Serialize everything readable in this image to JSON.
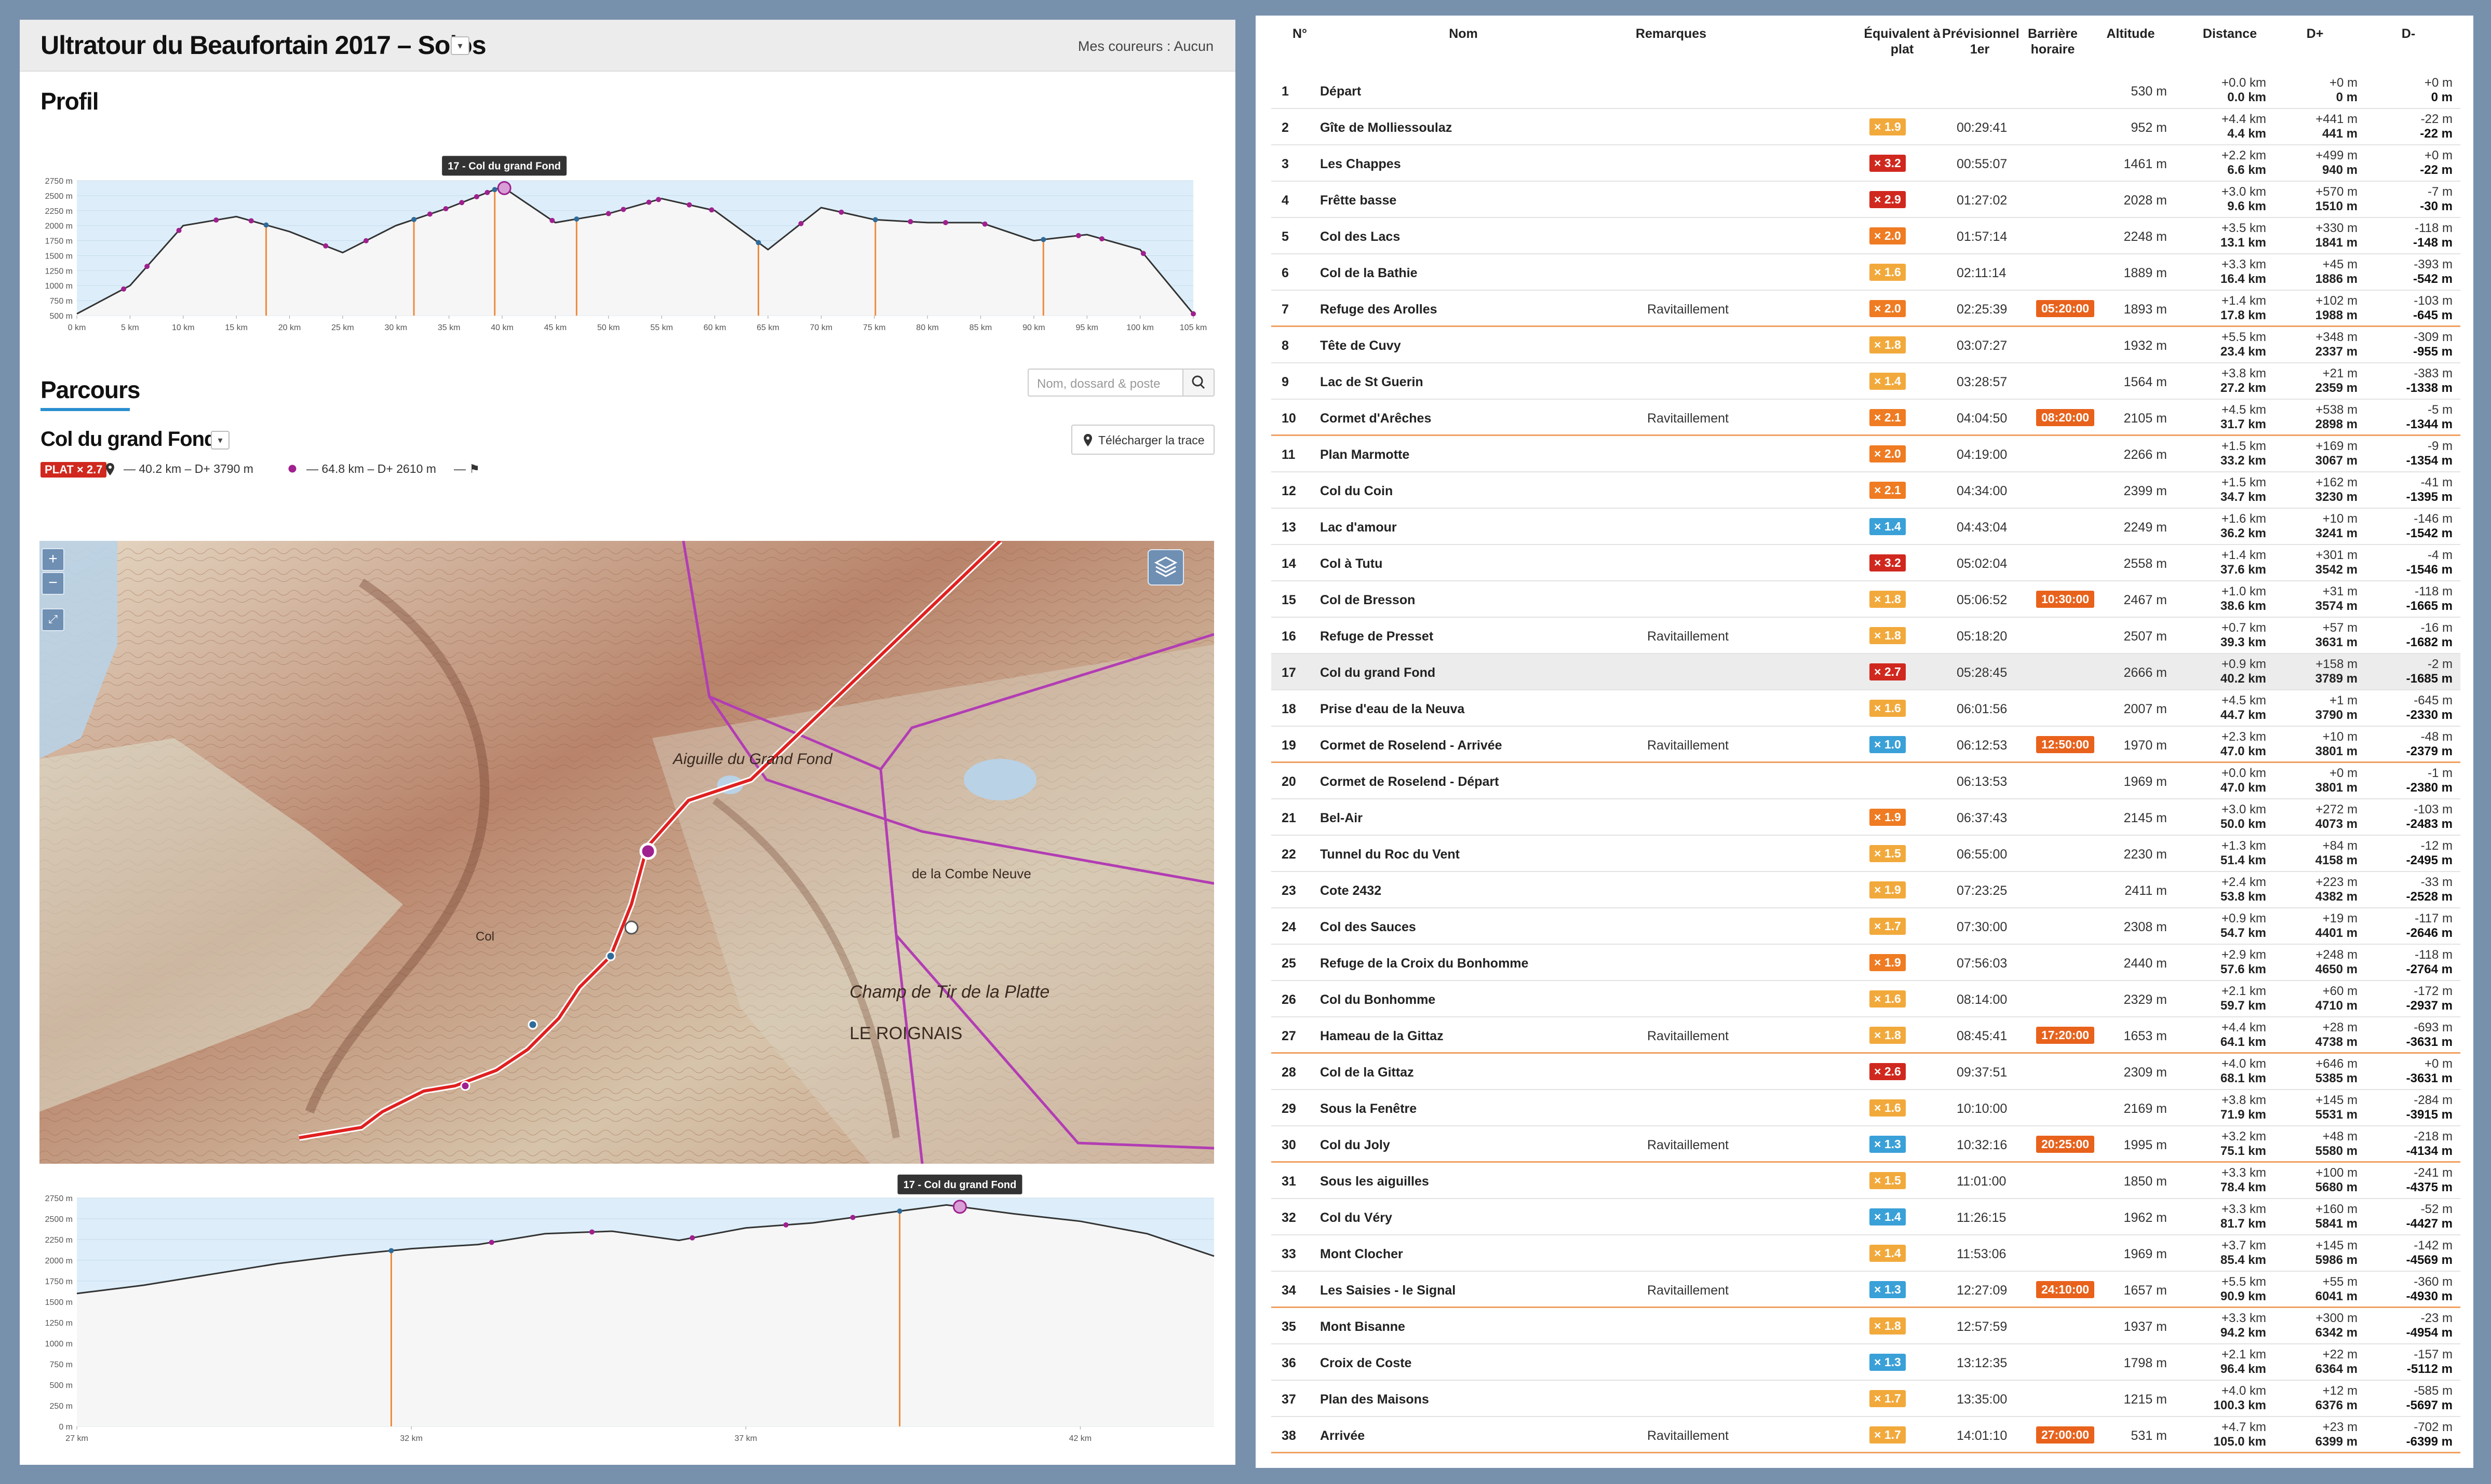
{
  "header": {
    "title": "Ultratour du Beaufortain 2017 – Solos",
    "mes_coureurs": "Mes coureurs : Aucun"
  },
  "profil": {
    "heading": "Profil",
    "tooltip": "17 - Col du grand Fond"
  },
  "parcours": {
    "heading": "Parcours",
    "search_placeholder": "Nom, dossard & poste",
    "section": "Col du grand Fond",
    "download": "Télécharger la trace",
    "plat_badge": "PLAT × 2.7",
    "from_stat": "40.2 km – D+ 3790 m",
    "to_stat": "64.8 km – D+ 2610 m"
  },
  "colors": {
    "accent": "#2a8fd0",
    "route": "#e02020",
    "checkpoint": "#a0208f",
    "barrier": "#e8621c",
    "eq_red": "#d0281e",
    "eq_orange": "#ef7b22",
    "eq_yellow": "#f2a93b",
    "eq_blue": "#3aa0d8"
  },
  "table": {
    "headers": {
      "n": "N°",
      "nom": "Nom",
      "rem": "Remarques",
      "eq": "Équivalent à plat",
      "prev": "Prévisionnel 1er",
      "bar": "Barrière horaire",
      "alt": "Altitude",
      "dist": "Distance",
      "dp": "D+",
      "dm": "D-"
    },
    "rows": [
      {
        "n": "1",
        "name": "Départ",
        "rem": "",
        "eq": "",
        "eqc": "",
        "prev": "",
        "bar": "",
        "alt": "530 m",
        "d1": "+0.0 km",
        "d2": "0.0 km",
        "p1": "+0 m",
        "p2": "0 m",
        "m1": "+0 m",
        "m2": "0 m"
      },
      {
        "n": "2",
        "name": "Gîte de Molliessoulaz",
        "rem": "",
        "eq": "× 1.9",
        "eqc": "y",
        "prev": "00:29:41",
        "bar": "",
        "alt": "952 m",
        "d1": "+4.4 km",
        "d2": "4.4 km",
        "p1": "+441 m",
        "p2": "441 m",
        "m1": "-22 m",
        "m2": "-22 m"
      },
      {
        "n": "3",
        "name": "Les Chappes",
        "rem": "",
        "eq": "× 3.2",
        "eqc": "r",
        "prev": "00:55:07",
        "bar": "",
        "alt": "1461 m",
        "d1": "+2.2 km",
        "d2": "6.6 km",
        "p1": "+499 m",
        "p2": "940 m",
        "m1": "+0 m",
        "m2": "-22 m"
      },
      {
        "n": "4",
        "name": "Frêtte basse",
        "rem": "",
        "eq": "× 2.9",
        "eqc": "r",
        "prev": "01:27:02",
        "bar": "",
        "alt": "2028 m",
        "d1": "+3.0 km",
        "d2": "9.6 km",
        "p1": "+570 m",
        "p2": "1510 m",
        "m1": "-7 m",
        "m2": "-30 m"
      },
      {
        "n": "5",
        "name": "Col des Lacs",
        "rem": "",
        "eq": "× 2.0",
        "eqc": "o",
        "prev": "01:57:14",
        "bar": "",
        "alt": "2248 m",
        "d1": "+3.5 km",
        "d2": "13.1 km",
        "p1": "+330 m",
        "p2": "1841 m",
        "m1": "-118 m",
        "m2": "-148 m"
      },
      {
        "n": "6",
        "name": "Col de la Bathie",
        "rem": "",
        "eq": "× 1.6",
        "eqc": "y",
        "prev": "02:11:14",
        "bar": "",
        "alt": "1889 m",
        "d1": "+3.3 km",
        "d2": "16.4 km",
        "p1": "+45 m",
        "p2": "1886 m",
        "m1": "-393 m",
        "m2": "-542 m"
      },
      {
        "n": "7",
        "name": "Refuge des Arolles",
        "rem": "Ravitaillement",
        "eq": "× 2.0",
        "eqc": "o",
        "prev": "02:25:39",
        "bar": "05:20:00",
        "alt": "1893 m",
        "d1": "+1.4 km",
        "d2": "17.8 km",
        "p1": "+102 m",
        "p2": "1988 m",
        "m1": "-103 m",
        "m2": "-645 m"
      },
      {
        "n": "8",
        "name": "Tête de Cuvy",
        "rem": "",
        "eq": "× 1.8",
        "eqc": "y",
        "prev": "03:07:27",
        "bar": "",
        "alt": "1932 m",
        "d1": "+5.5 km",
        "d2": "23.4 km",
        "p1": "+348 m",
        "p2": "2337 m",
        "m1": "-309 m",
        "m2": "-955 m"
      },
      {
        "n": "9",
        "name": "Lac de St Guerin",
        "rem": "",
        "eq": "× 1.4",
        "eqc": "y",
        "prev": "03:28:57",
        "bar": "",
        "alt": "1564 m",
        "d1": "+3.8 km",
        "d2": "27.2 km",
        "p1": "+21 m",
        "p2": "2359 m",
        "m1": "-383 m",
        "m2": "-1338 m"
      },
      {
        "n": "10",
        "name": "Cormet d'Arêches",
        "rem": "Ravitaillement",
        "eq": "× 2.1",
        "eqc": "o",
        "prev": "04:04:50",
        "bar": "08:20:00",
        "alt": "2105 m",
        "d1": "+4.5 km",
        "d2": "31.7 km",
        "p1": "+538 m",
        "p2": "2898 m",
        "m1": "-5 m",
        "m2": "-1344 m"
      },
      {
        "n": "11",
        "name": "Plan Marmotte",
        "rem": "",
        "eq": "× 2.0",
        "eqc": "o",
        "prev": "04:19:00",
        "bar": "",
        "alt": "2266 m",
        "d1": "+1.5 km",
        "d2": "33.2 km",
        "p1": "+169 m",
        "p2": "3067 m",
        "m1": "-9 m",
        "m2": "-1354 m"
      },
      {
        "n": "12",
        "name": "Col du Coin",
        "rem": "",
        "eq": "× 2.1",
        "eqc": "o",
        "prev": "04:34:00",
        "bar": "",
        "alt": "2399 m",
        "d1": "+1.5 km",
        "d2": "34.7 km",
        "p1": "+162 m",
        "p2": "3230 m",
        "m1": "-41 m",
        "m2": "-1395 m"
      },
      {
        "n": "13",
        "name": "Lac d'amour",
        "rem": "",
        "eq": "× 1.4",
        "eqc": "b",
        "prev": "04:43:04",
        "bar": "",
        "alt": "2249 m",
        "d1": "+1.6 km",
        "d2": "36.2 km",
        "p1": "+10 m",
        "p2": "3241 m",
        "m1": "-146 m",
        "m2": "-1542 m"
      },
      {
        "n": "14",
        "name": "Col à Tutu",
        "rem": "",
        "eq": "× 3.2",
        "eqc": "r",
        "prev": "05:02:04",
        "bar": "",
        "alt": "2558 m",
        "d1": "+1.4 km",
        "d2": "37.6 km",
        "p1": "+301 m",
        "p2": "3542 m",
        "m1": "-4 m",
        "m2": "-1546 m"
      },
      {
        "n": "15",
        "name": "Col de Bresson",
        "rem": "",
        "eq": "× 1.8",
        "eqc": "y",
        "prev": "05:06:52",
        "bar": "10:30:00",
        "alt": "2467 m",
        "d1": "+1.0 km",
        "d2": "38.6 km",
        "p1": "+31 m",
        "p2": "3574 m",
        "m1": "-118 m",
        "m2": "-1665 m"
      },
      {
        "n": "16",
        "name": "Refuge de Presset",
        "rem": "Ravitaillement",
        "eq": "× 1.8",
        "eqc": "y",
        "prev": "05:18:20",
        "bar": "",
        "alt": "2507 m",
        "d1": "+0.7 km",
        "d2": "39.3 km",
        "p1": "+57 m",
        "p2": "3631 m",
        "m1": "-16 m",
        "m2": "-1682 m"
      },
      {
        "n": "17",
        "name": "Col du grand Fond",
        "rem": "",
        "eq": "× 2.7",
        "eqc": "r",
        "prev": "05:28:45",
        "bar": "",
        "alt": "2666 m",
        "d1": "+0.9 km",
        "d2": "40.2 km",
        "p1": "+158 m",
        "p2": "3789 m",
        "m1": "-2 m",
        "m2": "-1685 m"
      },
      {
        "n": "18",
        "name": "Prise d'eau de la Neuva",
        "rem": "",
        "eq": "× 1.6",
        "eqc": "y",
        "prev": "06:01:56",
        "bar": "",
        "alt": "2007 m",
        "d1": "+4.5 km",
        "d2": "44.7 km",
        "p1": "+1 m",
        "p2": "3790 m",
        "m1": "-645 m",
        "m2": "-2330 m"
      },
      {
        "n": "19",
        "name": "Cormet de Roselend - Arrivée",
        "rem": "Ravitaillement",
        "eq": "× 1.0",
        "eqc": "b",
        "prev": "06:12:53",
        "bar": "12:50:00",
        "alt": "1970 m",
        "d1": "+2.3 km",
        "d2": "47.0 km",
        "p1": "+10 m",
        "p2": "3801 m",
        "m1": "-48 m",
        "m2": "-2379 m"
      },
      {
        "n": "20",
        "name": "Cormet de Roselend - Départ",
        "rem": "",
        "eq": "",
        "eqc": "",
        "prev": "06:13:53",
        "bar": "",
        "alt": "1969 m",
        "d1": "+0.0 km",
        "d2": "47.0 km",
        "p1": "+0 m",
        "p2": "3801 m",
        "m1": "-1 m",
        "m2": "-2380 m"
      },
      {
        "n": "21",
        "name": "Bel-Air",
        "rem": "",
        "eq": "× 1.9",
        "eqc": "o",
        "prev": "06:37:43",
        "bar": "",
        "alt": "2145 m",
        "d1": "+3.0 km",
        "d2": "50.0 km",
        "p1": "+272 m",
        "p2": "4073 m",
        "m1": "-103 m",
        "m2": "-2483 m"
      },
      {
        "n": "22",
        "name": "Tunnel du Roc du Vent",
        "rem": "",
        "eq": "× 1.5",
        "eqc": "y",
        "prev": "06:55:00",
        "bar": "",
        "alt": "2230 m",
        "d1": "+1.3 km",
        "d2": "51.4 km",
        "p1": "+84 m",
        "p2": "4158 m",
        "m1": "-12 m",
        "m2": "-2495 m"
      },
      {
        "n": "23",
        "name": "Cote 2432",
        "rem": "",
        "eq": "× 1.9",
        "eqc": "y",
        "prev": "07:23:25",
        "bar": "",
        "alt": "2411 m",
        "d1": "+2.4 km",
        "d2": "53.8 km",
        "p1": "+223 m",
        "p2": "4382 m",
        "m1": "-33 m",
        "m2": "-2528 m"
      },
      {
        "n": "24",
        "name": "Col des Sauces",
        "rem": "",
        "eq": "× 1.7",
        "eqc": "y",
        "prev": "07:30:00",
        "bar": "",
        "alt": "2308 m",
        "d1": "+0.9 km",
        "d2": "54.7 km",
        "p1": "+19 m",
        "p2": "4401 m",
        "m1": "-117 m",
        "m2": "-2646 m"
      },
      {
        "n": "25",
        "name": "Refuge de la Croix du Bonhomme",
        "rem": "",
        "eq": "× 1.9",
        "eqc": "o",
        "prev": "07:56:03",
        "bar": "",
        "alt": "2440 m",
        "d1": "+2.9 km",
        "d2": "57.6 km",
        "p1": "+248 m",
        "p2": "4650 m",
        "m1": "-118 m",
        "m2": "-2764 m"
      },
      {
        "n": "26",
        "name": "Col du Bonhomme",
        "rem": "",
        "eq": "× 1.6",
        "eqc": "y",
        "prev": "08:14:00",
        "bar": "",
        "alt": "2329 m",
        "d1": "+2.1 km",
        "d2": "59.7 km",
        "p1": "+60 m",
        "p2": "4710 m",
        "m1": "-172 m",
        "m2": "-2937 m"
      },
      {
        "n": "27",
        "name": "Hameau de la Gittaz",
        "rem": "Ravitaillement",
        "eq": "× 1.8",
        "eqc": "y",
        "prev": "08:45:41",
        "bar": "17:20:00",
        "alt": "1653 m",
        "d1": "+4.4 km",
        "d2": "64.1 km",
        "p1": "+28 m",
        "p2": "4738 m",
        "m1": "-693 m",
        "m2": "-3631 m"
      },
      {
        "n": "28",
        "name": "Col de la Gittaz",
        "rem": "",
        "eq": "× 2.6",
        "eqc": "r",
        "prev": "09:37:51",
        "bar": "",
        "alt": "2309 m",
        "d1": "+4.0 km",
        "d2": "68.1 km",
        "p1": "+646 m",
        "p2": "5385 m",
        "m1": "+0 m",
        "m2": "-3631 m"
      },
      {
        "n": "29",
        "name": "Sous la Fenêtre",
        "rem": "",
        "eq": "× 1.6",
        "eqc": "y",
        "prev": "10:10:00",
        "bar": "",
        "alt": "2169 m",
        "d1": "+3.8 km",
        "d2": "71.9 km",
        "p1": "+145 m",
        "p2": "5531 m",
        "m1": "-284 m",
        "m2": "-3915 m"
      },
      {
        "n": "30",
        "name": "Col du Joly",
        "rem": "Ravitaillement",
        "eq": "× 1.3",
        "eqc": "b",
        "prev": "10:32:16",
        "bar": "20:25:00",
        "alt": "1995 m",
        "d1": "+3.2 km",
        "d2": "75.1 km",
        "p1": "+48 m",
        "p2": "5580 m",
        "m1": "-218 m",
        "m2": "-4134 m"
      },
      {
        "n": "31",
        "name": "Sous les aiguilles",
        "rem": "",
        "eq": "× 1.5",
        "eqc": "y",
        "prev": "11:01:00",
        "bar": "",
        "alt": "1850 m",
        "d1": "+3.3 km",
        "d2": "78.4 km",
        "p1": "+100 m",
        "p2": "5680 m",
        "m1": "-241 m",
        "m2": "-4375 m"
      },
      {
        "n": "32",
        "name": "Col du Véry",
        "rem": "",
        "eq": "× 1.4",
        "eqc": "b",
        "prev": "11:26:15",
        "bar": "",
        "alt": "1962 m",
        "d1": "+3.3 km",
        "d2": "81.7 km",
        "p1": "+160 m",
        "p2": "5841 m",
        "m1": "-52 m",
        "m2": "-4427 m"
      },
      {
        "n": "33",
        "name": "Mont Clocher",
        "rem": "",
        "eq": "× 1.4",
        "eqc": "y",
        "prev": "11:53:06",
        "bar": "",
        "alt": "1969 m",
        "d1": "+3.7 km",
        "d2": "85.4 km",
        "p1": "+145 m",
        "p2": "5986 m",
        "m1": "-142 m",
        "m2": "-4569 m"
      },
      {
        "n": "34",
        "name": "Les Saisies - le Signal",
        "rem": "Ravitaillement",
        "eq": "× 1.3",
        "eqc": "b",
        "prev": "12:27:09",
        "bar": "24:10:00",
        "alt": "1657 m",
        "d1": "+5.5 km",
        "d2": "90.9 km",
        "p1": "+55 m",
        "p2": "6041 m",
        "m1": "-360 m",
        "m2": "-4930 m"
      },
      {
        "n": "35",
        "name": "Mont Bisanne",
        "rem": "",
        "eq": "× 1.8",
        "eqc": "y",
        "prev": "12:57:59",
        "bar": "",
        "alt": "1937 m",
        "d1": "+3.3 km",
        "d2": "94.2 km",
        "p1": "+300 m",
        "p2": "6342 m",
        "m1": "-23 m",
        "m2": "-4954 m"
      },
      {
        "n": "36",
        "name": "Croix de Coste",
        "rem": "",
        "eq": "× 1.3",
        "eqc": "b",
        "prev": "13:12:35",
        "bar": "",
        "alt": "1798 m",
        "d1": "+2.1 km",
        "d2": "96.4 km",
        "p1": "+22 m",
        "p2": "6364 m",
        "m1": "-157 m",
        "m2": "-5112 m"
      },
      {
        "n": "37",
        "name": "Plan des Maisons",
        "rem": "",
        "eq": "× 1.7",
        "eqc": "y",
        "prev": "13:35:00",
        "bar": "",
        "alt": "1215 m",
        "d1": "+4.0 km",
        "d2": "100.3 km",
        "p1": "+12 m",
        "p2": "6376 m",
        "m1": "-585 m",
        "m2": "-5697 m"
      },
      {
        "n": "38",
        "name": "Arrivée",
        "rem": "Ravitaillement",
        "eq": "× 1.7",
        "eqc": "y",
        "prev": "14:01:10",
        "bar": "27:00:00",
        "alt": "531 m",
        "d1": "+4.7 km",
        "d2": "105.0 km",
        "p1": "+23 m",
        "p2": "6399 m",
        "m1": "-702 m",
        "m2": "-6399 m"
      }
    ]
  },
  "chart_data": [
    {
      "type": "area",
      "x": [
        0,
        5,
        10,
        15,
        20,
        25,
        30,
        35,
        40,
        45,
        50,
        55,
        60,
        65,
        70,
        75,
        80,
        85,
        90,
        95,
        100,
        105
      ],
      "y": [
        530,
        1000,
        2000,
        2150,
        1900,
        1550,
        2000,
        2300,
        2650,
        2050,
        2200,
        2450,
        2250,
        1600,
        2300,
        2100,
        2050,
        2050,
        1750,
        1850,
        1600,
        530
      ],
      "checkpoints_km": [
        4.4,
        6.6,
        9.6,
        13.1,
        16.4,
        17.8,
        23.4,
        27.2,
        31.7,
        33.2,
        34.7,
        36.2,
        37.6,
        38.6,
        39.3,
        40.2,
        44.7,
        47.0,
        50.0,
        51.4,
        53.8,
        54.7,
        57.6,
        59.7,
        64.1,
        68.1,
        71.9,
        75.1,
        78.4,
        81.7,
        85.4,
        90.9,
        94.2,
        96.4,
        100.3,
        105.0
      ],
      "ravitaillement_km": [
        17.8,
        31.7,
        39.3,
        47.0,
        64.1,
        75.1,
        90.9
      ],
      "xticks": [
        "0 km",
        "5 km",
        "10 km",
        "15 km",
        "20 km",
        "25 km",
        "30 km",
        "35 km",
        "40 km",
        "45 km",
        "50 km",
        "55 km",
        "60 km",
        "65 km",
        "70 km",
        "75 km",
        "80 km",
        "85 km",
        "90 km",
        "95 km",
        "100 km",
        "105 km"
      ],
      "yticks": [
        "500 m",
        "750 m",
        "1000 m",
        "1250 m",
        "1500 m",
        "1750 m",
        "2000 m",
        "2250 m",
        "2500 m",
        "2750 m"
      ],
      "ylim": [
        500,
        2750
      ],
      "xlim": [
        0,
        105
      ],
      "highlight_km": 40.2,
      "tooltip": "17 - Col du grand Fond"
    },
    {
      "type": "area",
      "x": [
        27,
        28,
        29,
        30,
        31,
        32,
        33,
        34,
        35,
        36,
        37,
        38,
        39,
        40,
        41,
        42,
        43,
        44
      ],
      "y": [
        1600,
        1700,
        1830,
        1960,
        2060,
        2140,
        2190,
        2320,
        2350,
        2240,
        2390,
        2450,
        2560,
        2666,
        2560,
        2470,
        2320,
        2050
      ],
      "checkpoints_km": [
        31.7,
        33.2,
        34.7,
        36.2,
        37.6,
        38.6,
        39.3,
        40.2
      ],
      "ravitaillement_km": [
        31.7,
        39.3
      ],
      "xticks": [
        "27 km",
        "32 km",
        "37 km",
        "42 km"
      ],
      "yticks": [
        "0 m",
        "250 m",
        "500 m",
        "750 m",
        "1000 m",
        "1250 m",
        "1500 m",
        "1750 m",
        "2000 m",
        "2250 m",
        "2500 m",
        "2750 m"
      ],
      "ylim": [
        0,
        2750
      ],
      "xlim": [
        27,
        44
      ],
      "highlight_km": 40.2,
      "tooltip": "17 - Col du grand Fond"
    }
  ]
}
